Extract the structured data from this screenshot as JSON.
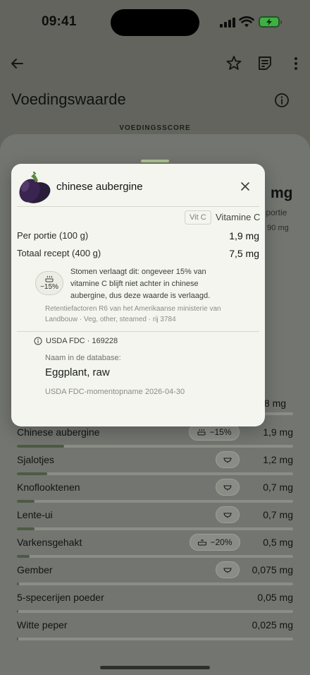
{
  "status": {
    "time": "09:41"
  },
  "header": {
    "title": "Voedingswaarde",
    "score_label": "VOEDINGSSCORE"
  },
  "peek": {
    "big_value": "mg",
    "small1": "r portie",
    "small2": "n 90 mg",
    "first_row_value": ",8 mg"
  },
  "card": {
    "food_name": "chinese aubergine",
    "vitamin_tag": "Vit C",
    "vitamin_name": "Vitamine C",
    "per_portion_label": "Per portie (100 g)",
    "per_portion_value": "1,9 mg",
    "total_label": "Totaal recept (400 g)",
    "total_value": "7,5 mg",
    "retention_pct": "−15%",
    "retention_text": "Stomen verlaagt dit: ongeveer 15% van vitamine C blijft niet achter in chinese aubergine, dus deze waarde is verlaagd.",
    "retention_source": "Retentiefactoren R6 van het Amerikaanse ministerie van Landbouw · Veg, other, steamed · rij 3784",
    "usda_id": "USDA FDC · 169228",
    "db_label": "Naam in de database:",
    "db_name": "Eggplant, raw",
    "snapshot": "USDA FDC-momentopname 2026-04-30"
  },
  "ingredients": [
    {
      "name": "Chinese aubergine",
      "value": "1,9 mg",
      "chip": "−15%",
      "chip_icon": "steam-pot-icon",
      "fill": 0.17
    },
    {
      "name": "Sjalotjes",
      "value": "1,2 mg",
      "chip": "",
      "chip_icon": "raw-bowl-icon",
      "fill": 0.11
    },
    {
      "name": "Knoflooktenen",
      "value": "0,7 mg",
      "chip": "",
      "chip_icon": "raw-bowl-icon",
      "fill": 0.065
    },
    {
      "name": "Lente-ui",
      "value": "0,7 mg",
      "chip": "",
      "chip_icon": "raw-bowl-icon",
      "fill": 0.065
    },
    {
      "name": "Varkensgehakt",
      "value": "0,5 mg",
      "chip": "−20%",
      "chip_icon": "pan-icon",
      "fill": 0.046
    },
    {
      "name": "Gember",
      "value": "0,075 mg",
      "chip": "",
      "chip_icon": "raw-bowl-icon",
      "fill": 0.007
    },
    {
      "name": "5-specerijen poeder",
      "value": "0,05 mg",
      "chip": "",
      "chip_icon": "",
      "fill": 0.005
    },
    {
      "name": "Witte peper",
      "value": "0,025 mg",
      "chip": "",
      "chip_icon": "",
      "fill": 0.003
    }
  ],
  "colors": {
    "accent_fill": "#4e5b44",
    "sheet_bg": "#737570",
    "card_bg": "#f3f5ee",
    "battery": "#3fb043"
  }
}
